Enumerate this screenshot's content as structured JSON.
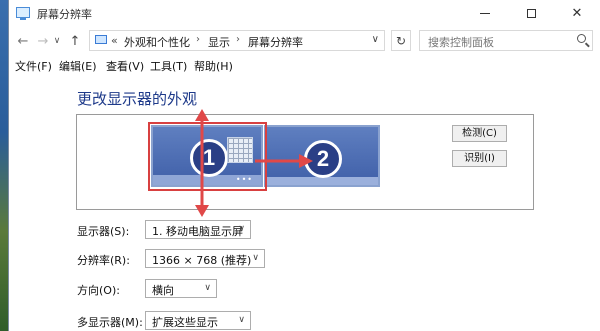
{
  "window": {
    "title": "屏幕分辨率",
    "minimize_glyph": "—",
    "maximize_glyph": "☐",
    "close_glyph": "✕"
  },
  "navigation": {
    "back_glyph": "←",
    "forward_glyph": "→",
    "recent_glyph": "∨",
    "up_glyph": "↑",
    "address_prefix": "«",
    "breadcrumbs": [
      "外观和个性化",
      "显示",
      "屏幕分辨率"
    ],
    "separator": "›",
    "dropdown_glyph": "∨",
    "refresh_glyph": "↻",
    "search_placeholder": "搜索控制面板"
  },
  "menu": {
    "items": [
      "文件(F)",
      "编辑(E)",
      "查看(V)",
      "工具(T)",
      "帮助(H)"
    ]
  },
  "main": {
    "heading": "更改显示器的外观",
    "monitors": [
      {
        "number": "1",
        "selected": true
      },
      {
        "number": "2",
        "selected": false
      }
    ],
    "detect_button": "检测(C)",
    "identify_button": "识别(I)",
    "fields": [
      {
        "label": "显示器(S):",
        "value": "1. 移动电脑显示屏"
      },
      {
        "label": "分辨率(R):",
        "value": "1366 × 768 (推荐)"
      },
      {
        "label": "方向(O):",
        "value": "横向"
      },
      {
        "label": "多显示器(M):",
        "value": "扩展这些显示"
      }
    ],
    "combo_arrow": "∨"
  },
  "colors": {
    "accent_heading": "#1e3a8a",
    "monitor_fill": "#4a6bb5",
    "selection_border": "#d84040",
    "arrow_color": "#e04848"
  }
}
